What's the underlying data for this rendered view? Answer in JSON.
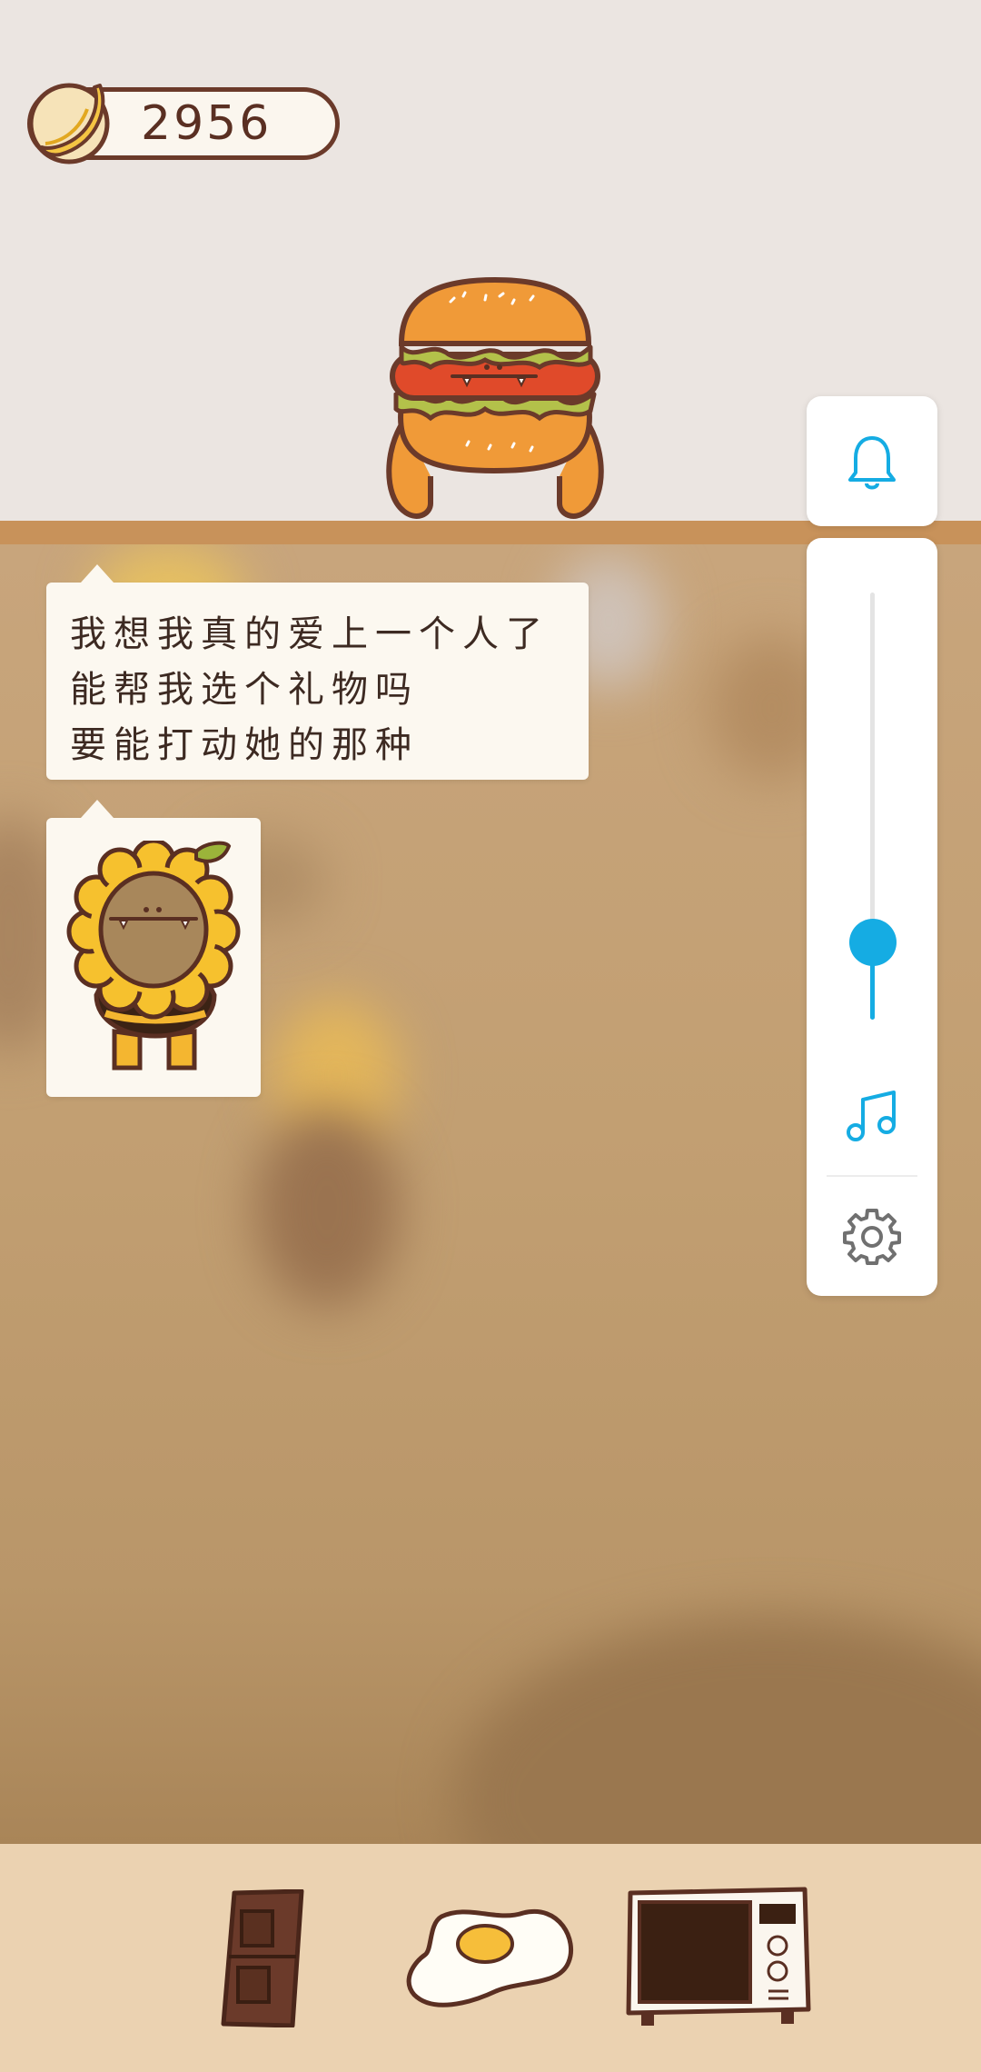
{
  "currency": {
    "icon": "banana-icon",
    "amount": "2956"
  },
  "speech": {
    "lines": [
      "我想我真的爱上一个人了",
      "能帮我选个礼物吗",
      "要能打动她的那种"
    ]
  },
  "gift_hint": {
    "icon": "sunflower-costume-character"
  },
  "controls": {
    "notification_icon": "bell-icon",
    "volume_level": 0.18,
    "music_icon": "music-note-icon",
    "settings_icon": "gear-icon",
    "accent_color": "#15ace3"
  },
  "characters": {
    "visitor": "hamburger-costume-character"
  },
  "tray": {
    "items": [
      {
        "name": "chocolate-bar"
      },
      {
        "name": "fried-egg"
      },
      {
        "name": "microwave-oven"
      }
    ]
  },
  "colors": {
    "outline": "#5a2f22",
    "shelf": "#c8925a",
    "tray_bg": "#ebd2b1",
    "room_bg": "#ebe5e1"
  }
}
